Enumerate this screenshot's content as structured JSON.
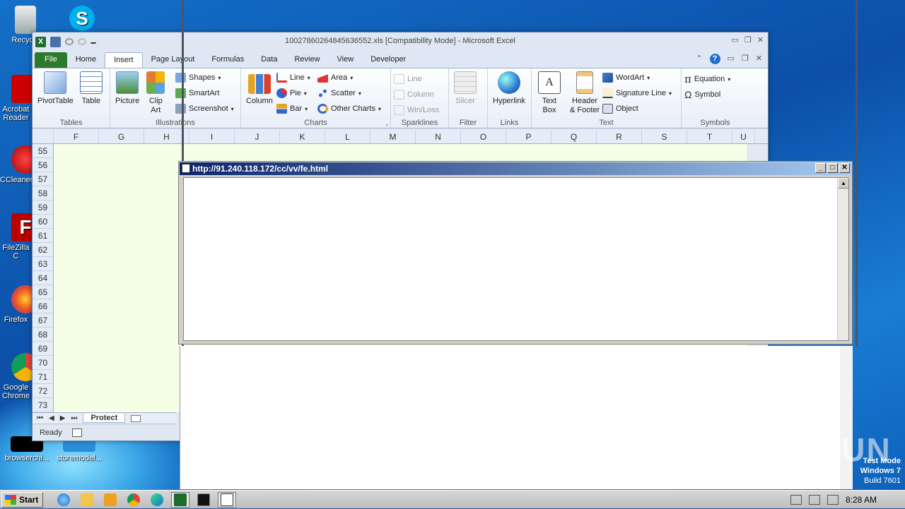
{
  "desktop": {
    "icons": [
      {
        "label": "Recycle",
        "icon": "recycle-bin-icon"
      },
      {
        "label": "Skype",
        "icon": "skype-icon"
      },
      {
        "label": "Acrobat Reader",
        "icon": "acrobat-icon"
      },
      {
        "label": "CCleaner",
        "icon": "ccleaner-icon"
      },
      {
        "label": "FileZilla C",
        "icon": "filezilla-icon"
      },
      {
        "label": "Firefox",
        "icon": "firefox-icon"
      },
      {
        "label": "Google Chrome",
        "icon": "chrome-icon"
      },
      {
        "label": "browserchi...",
        "icon": "file-icon"
      },
      {
        "label": "storemodel...",
        "icon": "file-icon"
      }
    ],
    "watermark": {
      "line1": "Test Mode",
      "line2": "Windows 7",
      "line3": "Build 7601"
    },
    "logo_text": "ANY RUN"
  },
  "excel": {
    "title": "10027860264845636552.xls  [Compatibility Mode]  -  Microsoft Excel",
    "tabs": [
      "File",
      "Home",
      "Insert",
      "Page Layout",
      "Formulas",
      "Data",
      "Review",
      "View",
      "Developer"
    ],
    "active_tab": "Insert",
    "groups": {
      "tables": {
        "label": "Tables",
        "pivot": "PivotTable",
        "table": "Table"
      },
      "illustrations": {
        "label": "Illustrations",
        "picture": "Picture",
        "clipart": "Clip Art",
        "shapes": "Shapes",
        "smartart": "SmartArt",
        "screenshot": "Screenshot"
      },
      "charts": {
        "label": "Charts",
        "column": "Column",
        "line": "Line",
        "pie": "Pie",
        "bar": "Bar",
        "area": "Area",
        "scatter": "Scatter",
        "other": "Other Charts"
      },
      "sparklines": {
        "label": "Sparklines",
        "line": "Line",
        "column": "Column",
        "winloss": "Win/Loss"
      },
      "filter": {
        "label": "Filter",
        "slicer": "Slicer"
      },
      "links": {
        "label": "Links",
        "hyperlink": "Hyperlink"
      },
      "text": {
        "label": "Text",
        "textbox": "Text Box",
        "header": "Header & Footer",
        "wordart": "WordArt",
        "signature": "Signature Line",
        "object": "Object"
      },
      "symbols": {
        "label": "Symbols",
        "equation": "Equation",
        "symbol": "Symbol"
      }
    },
    "columns": [
      "F",
      "G",
      "H",
      "I",
      "J",
      "K",
      "L",
      "M",
      "N",
      "O",
      "P",
      "Q",
      "R",
      "S",
      "T",
      "U"
    ],
    "rows": [
      "55",
      "56",
      "57",
      "58",
      "59",
      "60",
      "61",
      "62",
      "63",
      "64",
      "65",
      "66",
      "67",
      "68",
      "69",
      "70",
      "71",
      "72",
      "73"
    ],
    "sheet_tab": "Protect",
    "status": "Ready"
  },
  "popup": {
    "title": "http://91.240.118.172/cc/vv/fe.html"
  },
  "taskbar": {
    "start": "Start",
    "time": "8:28 AM"
  }
}
